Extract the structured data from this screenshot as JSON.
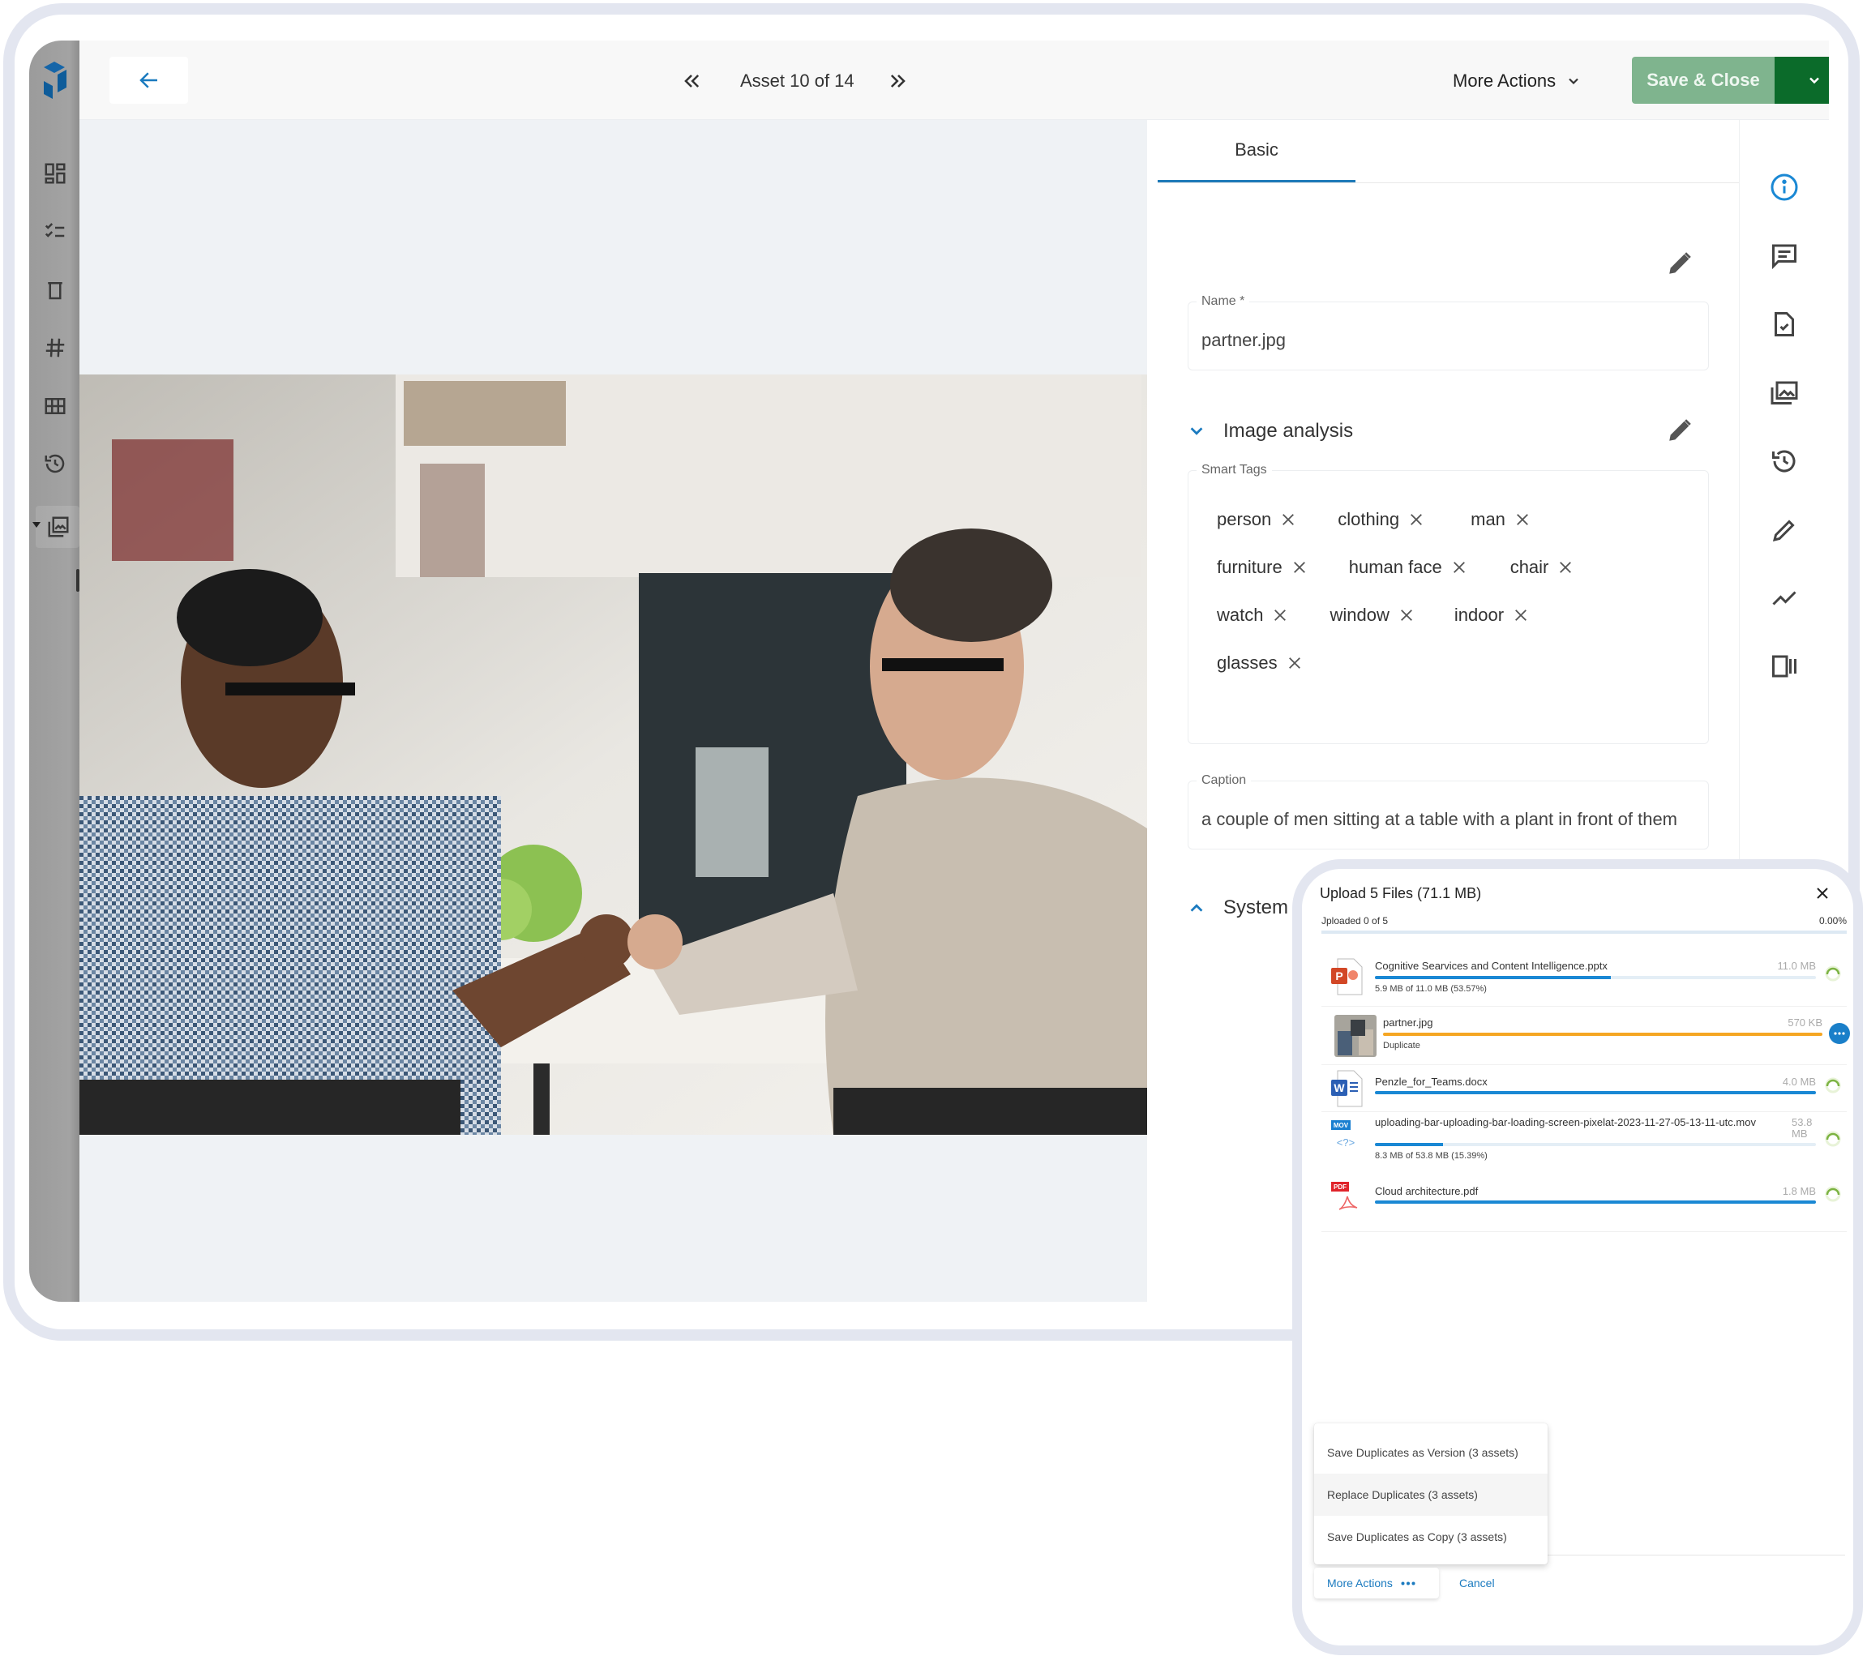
{
  "header": {
    "back_label": "Back",
    "prev_label": "Previous asset",
    "asset_counter": "Asset 10 of 14",
    "next_label": "Next asset",
    "more_actions": "More Actions",
    "save_close": "Save & Close"
  },
  "sidebar": {
    "items": [
      {
        "icon": "dashboard-icon"
      },
      {
        "icon": "checklist-icon"
      },
      {
        "icon": "trash-icon"
      },
      {
        "icon": "hashtag-icon"
      },
      {
        "icon": "grid-icon"
      },
      {
        "icon": "history-icon"
      },
      {
        "icon": "image-library-icon",
        "active": true
      }
    ]
  },
  "viewer": {
    "image_name": "partner.jpg",
    "image_description": "Two men fist-bumping at an office desk"
  },
  "panel": {
    "tab": "Basic",
    "name_label": "Name *",
    "name_value": "partner.jpg",
    "image_analysis_title": "Image analysis",
    "smart_tags_label": "Smart Tags",
    "smart_tags": [
      [
        "person",
        "clothing",
        "man"
      ],
      [
        "furniture",
        "human face",
        "chair"
      ],
      [
        "watch",
        "window",
        "indoor"
      ],
      [
        "glasses"
      ]
    ],
    "caption_label": "Caption",
    "caption_value": "a couple of men sitting at a table with a plant in front of them",
    "system_section": "System pr"
  },
  "rail": {
    "items": [
      "info-icon",
      "comment-icon",
      "file-check-icon",
      "image-gallery-icon",
      "history-icon",
      "edit-icon",
      "analytics-icon",
      "compare-icon"
    ],
    "active_color": "#1a88d4"
  },
  "upload": {
    "title": "Upload 5 Files (71.1 MB)",
    "uploaded": "Jploaded 0 of 5",
    "overall_percent": "0.00%",
    "files": [
      {
        "name": "Cognitive Searvices and Content Intelligence.pptx",
        "size": "11.0 MB",
        "detail": "5.9 MB of 11.0 MB (53.57%)",
        "progress": 0.5357,
        "type": "pptx",
        "status": "uploading"
      },
      {
        "name": "partner.jpg",
        "size": "570 KB",
        "detail": "Duplicate",
        "progress": 1.0,
        "type": "jpg",
        "status": "duplicate"
      },
      {
        "name": "Penzle_for_Teams.docx",
        "size": "4.0 MB",
        "detail": "",
        "progress": 1.0,
        "type": "docx",
        "status": "uploading"
      },
      {
        "name": "uploading-bar-uploading-bar-loading-screen-pixelat-2023-11-27-05-13-11-utc.mov",
        "size": "53.8 MB",
        "detail": "8.3 MB of 53.8 MB (15.39%)",
        "progress": 0.1539,
        "type": "mov",
        "status": "uploading"
      },
      {
        "name": "Cloud architecture.pdf",
        "size": "1.8 MB",
        "detail": "",
        "progress": 1.0,
        "type": "pdf",
        "status": "uploading"
      }
    ],
    "menu": [
      "Save Duplicates as Version (3 assets)",
      "Replace Duplicates (3 assets)",
      "Save Duplicates as Copy (3 assets)"
    ],
    "more_actions": "More Actions",
    "cancel": "Cancel",
    "colors": {
      "progress": "#1a88d4",
      "duplicate": "#f5a623"
    }
  }
}
